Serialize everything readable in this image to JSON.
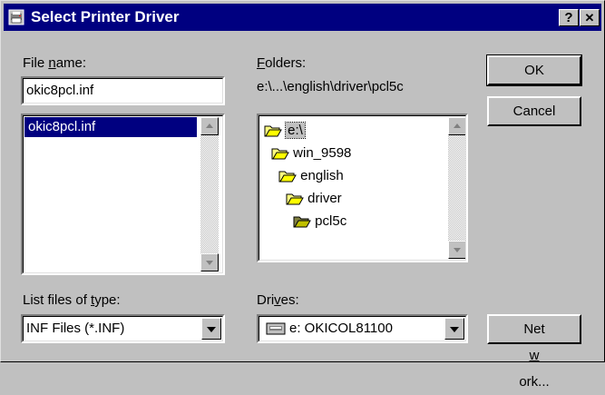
{
  "window": {
    "title": "Select Printer Driver",
    "help_label": "?",
    "close_label": "✕"
  },
  "filename": {
    "label_pre": "File ",
    "label_u": "n",
    "label_post": "ame:",
    "value": "okic8pcl.inf",
    "items": [
      "okic8pcl.inf"
    ]
  },
  "folders": {
    "label_u": "F",
    "label_post": "olders:",
    "path": "e:\\...\\english\\driver\\pcl5c",
    "items": [
      "e:\\",
      "win_9598",
      "english",
      "driver",
      "pcl5c"
    ]
  },
  "filetype": {
    "label_pre": "List files of ",
    "label_u": "t",
    "label_post": "ype:",
    "value": "INF Files (*.INF)"
  },
  "drives": {
    "label_pre": "Dri",
    "label_u": "v",
    "label_post": "es:",
    "value": "e: OKICOL81100"
  },
  "buttons": {
    "ok": "OK",
    "cancel": "Cancel",
    "network_pre": "Net",
    "network_u": "w",
    "network_post": "ork..."
  },
  "colors": {
    "title_bg": "#000080",
    "selection": "#000080",
    "face": "#c0c0c0"
  }
}
